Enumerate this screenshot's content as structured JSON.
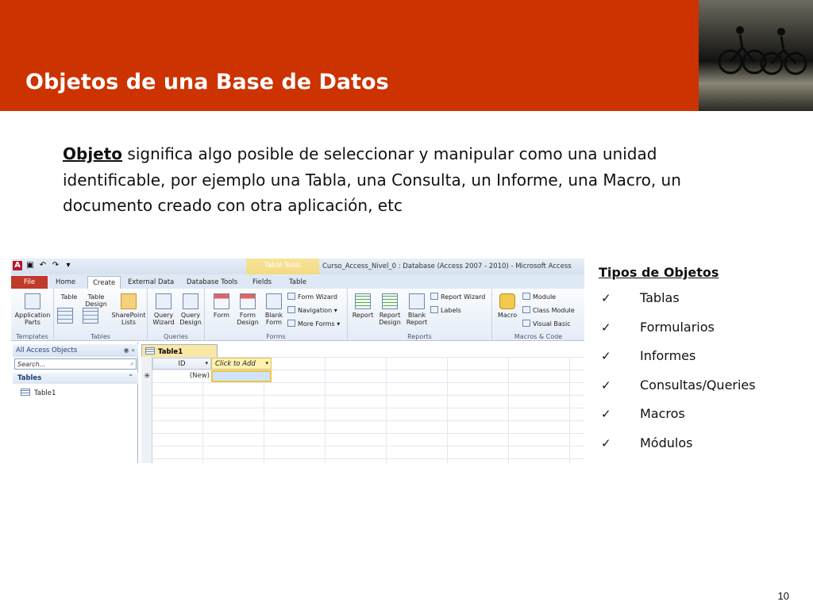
{
  "slide": {
    "title": "Objetos de una Base de Datos",
    "page_number": "10"
  },
  "definition": {
    "term": "Objeto",
    "text": " significa algo posible de seleccionar y manipular como una unidad identificable, por ejemplo una Tabla, una Consulta, un Informe, una Macro, un documento creado con otra aplicación, etc"
  },
  "access": {
    "window_title": "Curso_Access_Nivel_0 : Database (Access 2007 - 2010)  -  Microsoft Access",
    "contextual_tab": "Table Tools",
    "tabs": [
      "File",
      "Home",
      "Create",
      "External Data",
      "Database Tools",
      "Fields",
      "Table"
    ],
    "ribbon": {
      "templates": {
        "label": "Templates",
        "button": "Application Parts"
      },
      "tables": {
        "label": "Tables",
        "buttons": [
          "Table",
          "Table Design",
          "SharePoint Lists"
        ]
      },
      "queries": {
        "label": "Queries",
        "buttons": [
          "Query Wizard",
          "Query Design"
        ]
      },
      "forms": {
        "label": "Forms",
        "buttons": [
          "Form",
          "Form Design",
          "Blank Form"
        ],
        "small": [
          "Form Wizard",
          "Navigation",
          "More Forms"
        ]
      },
      "reports": {
        "label": "Reports",
        "buttons": [
          "Report",
          "Report Design",
          "Blank Report"
        ],
        "small": [
          "Report Wizard",
          "Labels"
        ]
      },
      "macros": {
        "label": "Macros & Code",
        "button": "Macro",
        "small": [
          "Module",
          "Class Module",
          "Visual Basic"
        ]
      }
    },
    "nav_pane": {
      "header": "All Access Objects",
      "search_placeholder": "Search...",
      "section": "Tables",
      "items": [
        "Table1"
      ]
    },
    "document": {
      "tab": "Table1",
      "columns": [
        "ID",
        "Click to Add"
      ],
      "new_row_value": "(New)"
    }
  },
  "tipos": {
    "title": "Tipos de Objetos",
    "items": [
      "Tablas",
      "Formularios",
      "Informes",
      "Consultas/Queries",
      "Macros",
      "Módulos"
    ]
  }
}
